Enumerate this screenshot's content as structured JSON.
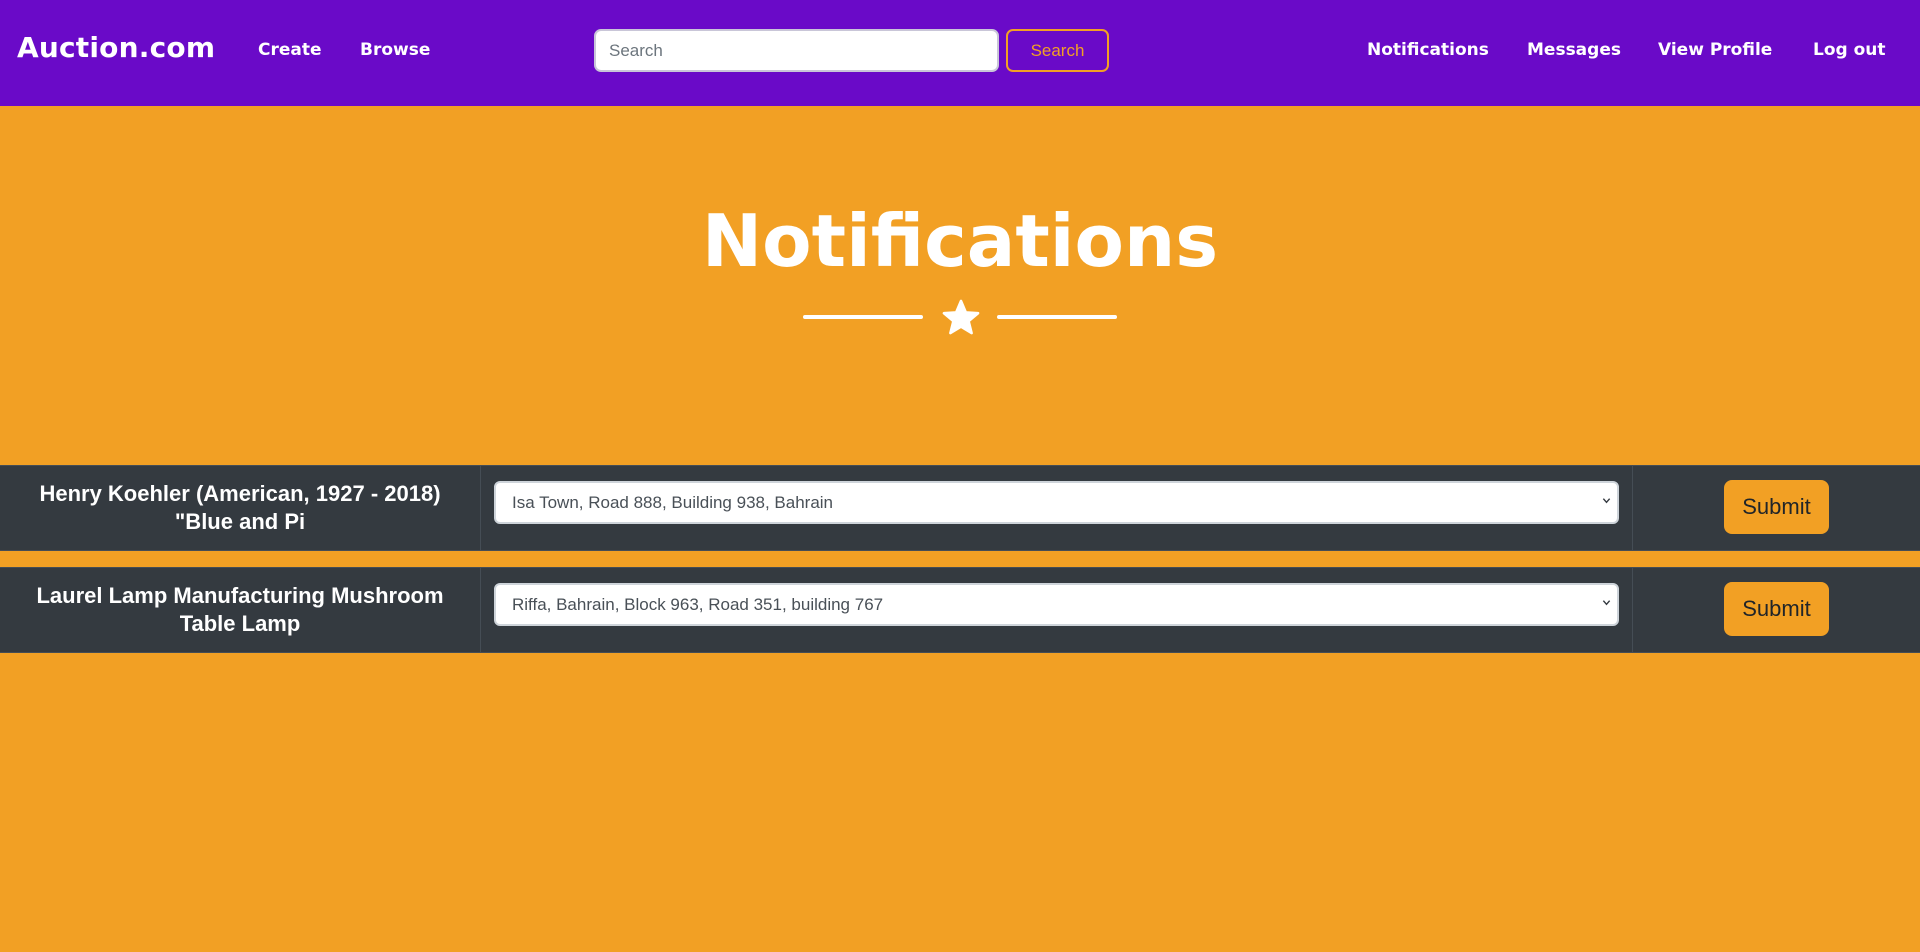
{
  "navbar": {
    "brand": "Auction.com",
    "links_left": [
      "Create",
      "Browse"
    ],
    "search": {
      "placeholder": "Search",
      "value": "",
      "button_label": "Search"
    },
    "links_right": [
      "Notifications",
      "Messages",
      "View Profile",
      "Log out"
    ]
  },
  "header": {
    "title": "Notifications",
    "divider_icon": "star-icon"
  },
  "notifications": [
    {
      "item_title": "Henry Koehler (American, 1927 - 2018) \"Blue and Pi",
      "selected_address": "Isa Town, Road 888, Building 938, Bahrain",
      "submit_label": "Submit"
    },
    {
      "item_title": "Laurel Lamp Manufacturing Mushroom Table Lamp",
      "selected_address": "Riffa, Bahrain, Block 963, Road 351, building 767",
      "submit_label": "Submit"
    }
  ],
  "colors": {
    "navbar_bg": "#6a0ac8",
    "page_bg": "#f2a024",
    "row_bg": "#343a40",
    "accent": "#f2a024",
    "text_light": "#ffffff"
  }
}
